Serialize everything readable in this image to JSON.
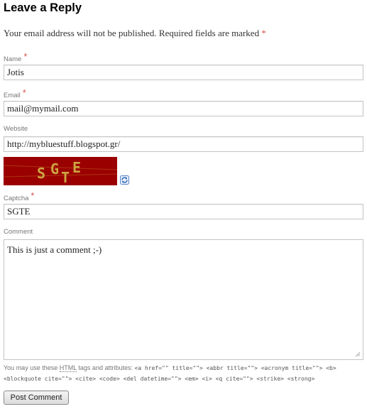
{
  "reply": {
    "title": "Leave a Reply",
    "notes": "Your email address will not be published. Required fields are marked",
    "required_mark": "*"
  },
  "fields": {
    "name": {
      "label": "Name",
      "value": "Jotis",
      "required": true
    },
    "email": {
      "label": "Email",
      "value": "mail@mymail.com",
      "required": true
    },
    "website": {
      "label": "Website",
      "value": "http://mybluestuff.blogspot.gr/",
      "required": false
    },
    "captcha": {
      "label": "Captcha",
      "value": "SGTE",
      "required": true,
      "image_text": "SGTE",
      "image_bg": "#9b0000",
      "image_fg": "#d4b84a",
      "refresh_icon": "refresh-icon"
    },
    "comment": {
      "label": "Comment",
      "value": "This is just a comment ;-)"
    }
  },
  "allowed_tags": {
    "prefix": "You may use these",
    "abbr": "HTML",
    "middle": "tags and attributes:",
    "code": "<a href=\"\" title=\"\"> <abbr title=\"\"> <acronym title=\"\"> <b> <blockquote cite=\"\"> <cite> <code> <del datetime=\"\"> <em> <i> <q cite=\"\"> <strike> <strong>"
  },
  "submit": {
    "label": "Post Comment"
  },
  "colors": {
    "required": "#d9534f",
    "label": "#777777",
    "border": "#c4c4c4"
  }
}
